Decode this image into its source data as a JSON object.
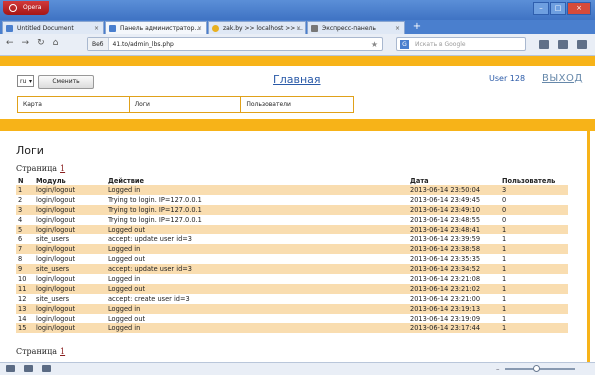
{
  "browser": {
    "app_name": "Opera",
    "tabs": [
      {
        "label": "Untitled Document",
        "active": false
      },
      {
        "label": "Панель администратор...",
        "active": true
      },
      {
        "label": "zak.by >> localhost >> ...",
        "active": false
      },
      {
        "label": "Экспресс-панель",
        "active": false
      }
    ],
    "new_tab": "+",
    "address_site": "Веб",
    "address_url": "41.to/admin_lbs.php",
    "search_placeholder": "Искать в Google",
    "search_engine": "G"
  },
  "header": {
    "lang_value": "ru",
    "change_button": "Сменить",
    "home_link": "Главная",
    "user": "User 128",
    "logout": "ВЫХОД"
  },
  "menu": [
    "Карта",
    "Логи",
    "Пользователи"
  ],
  "page": {
    "title": "Логи",
    "pager_label": "Страница",
    "pager_page": "1"
  },
  "table": {
    "headers": [
      "N",
      "Модуль",
      "Действие",
      "Дата",
      "Пользователь"
    ],
    "rows": [
      [
        "1",
        "login/logout",
        "Logged in",
        "2013-06-14 23:50:04",
        "3"
      ],
      [
        "2",
        "login/logout",
        "Trying to login. IP=127.0.0.1",
        "2013-06-14 23:49:45",
        "0"
      ],
      [
        "3",
        "login/logout",
        "Trying to login. IP=127.0.0.1",
        "2013-06-14 23:49:10",
        "0"
      ],
      [
        "4",
        "login/logout",
        "Trying to login. IP=127.0.0.1",
        "2013-06-14 23:48:55",
        "0"
      ],
      [
        "5",
        "login/logout",
        "Logged out",
        "2013-06-14 23:48:41",
        "1"
      ],
      [
        "6",
        "site_users",
        "accept: update user id=3",
        "2013-06-14 23:39:59",
        "1"
      ],
      [
        "7",
        "login/logout",
        "Logged in",
        "2013-06-14 23:38:58",
        "1"
      ],
      [
        "8",
        "login/logout",
        "Logged out",
        "2013-06-14 23:35:35",
        "1"
      ],
      [
        "9",
        "site_users",
        "accept: update user id=3",
        "2013-06-14 23:34:52",
        "1"
      ],
      [
        "10",
        "login/logout",
        "Logged in",
        "2013-06-14 23:21:08",
        "1"
      ],
      [
        "11",
        "login/logout",
        "Logged out",
        "2013-06-14 23:21:02",
        "1"
      ],
      [
        "12",
        "site_users",
        "accept: create user id=3",
        "2013-06-14 23:21:00",
        "1"
      ],
      [
        "13",
        "login/logout",
        "Logged in",
        "2013-06-14 23:19:13",
        "1"
      ],
      [
        "14",
        "login/logout",
        "Logged out",
        "2013-06-14 23:19:09",
        "1"
      ],
      [
        "15",
        "login/logout",
        "Logged in",
        "2013-06-14 23:17:44",
        "1"
      ]
    ]
  },
  "colors": {
    "accent_band": "#f7b318",
    "odd_row": "#f9ddb0",
    "link": "#2a5aa8"
  }
}
